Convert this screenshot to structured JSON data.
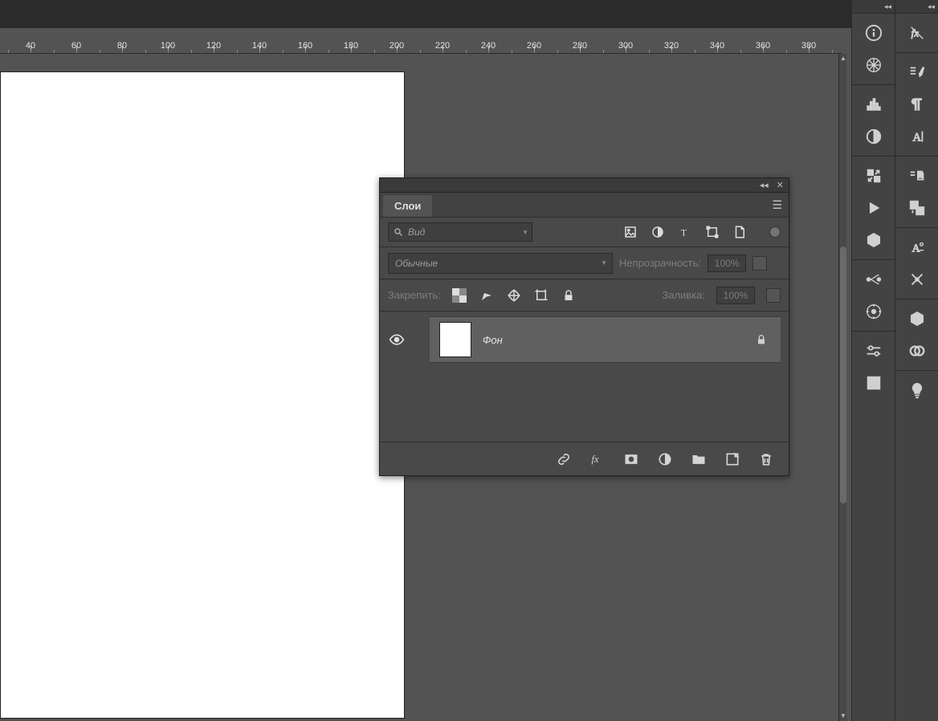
{
  "ruler": {
    "ticks": [
      40,
      60,
      80,
      100,
      120,
      140,
      160,
      180,
      200,
      220,
      240,
      260,
      280,
      300,
      320,
      340,
      360,
      380
    ]
  },
  "layersPanel": {
    "tab": "Слои",
    "search_placeholder": "Вид",
    "blend_mode": "Обычные",
    "opacity_label": "Непрозрачность:",
    "opacity_value": "100%",
    "lock_label": "Закрепить:",
    "fill_label": "Заливка:",
    "fill_value": "100%",
    "layer_name": "Фон"
  },
  "rightPanels": {
    "col1": [
      "info",
      "navigator",
      "histogram",
      "contrast",
      "swap",
      "play",
      "3d-axis",
      "path-edit",
      "3d-scene",
      "adjust",
      "grid"
    ],
    "col2": [
      "fx",
      "brush",
      "paragraph",
      "text-a",
      "stamp",
      "smart-object",
      "char-a",
      "scissors",
      "cube",
      "cc",
      "bulb"
    ]
  }
}
